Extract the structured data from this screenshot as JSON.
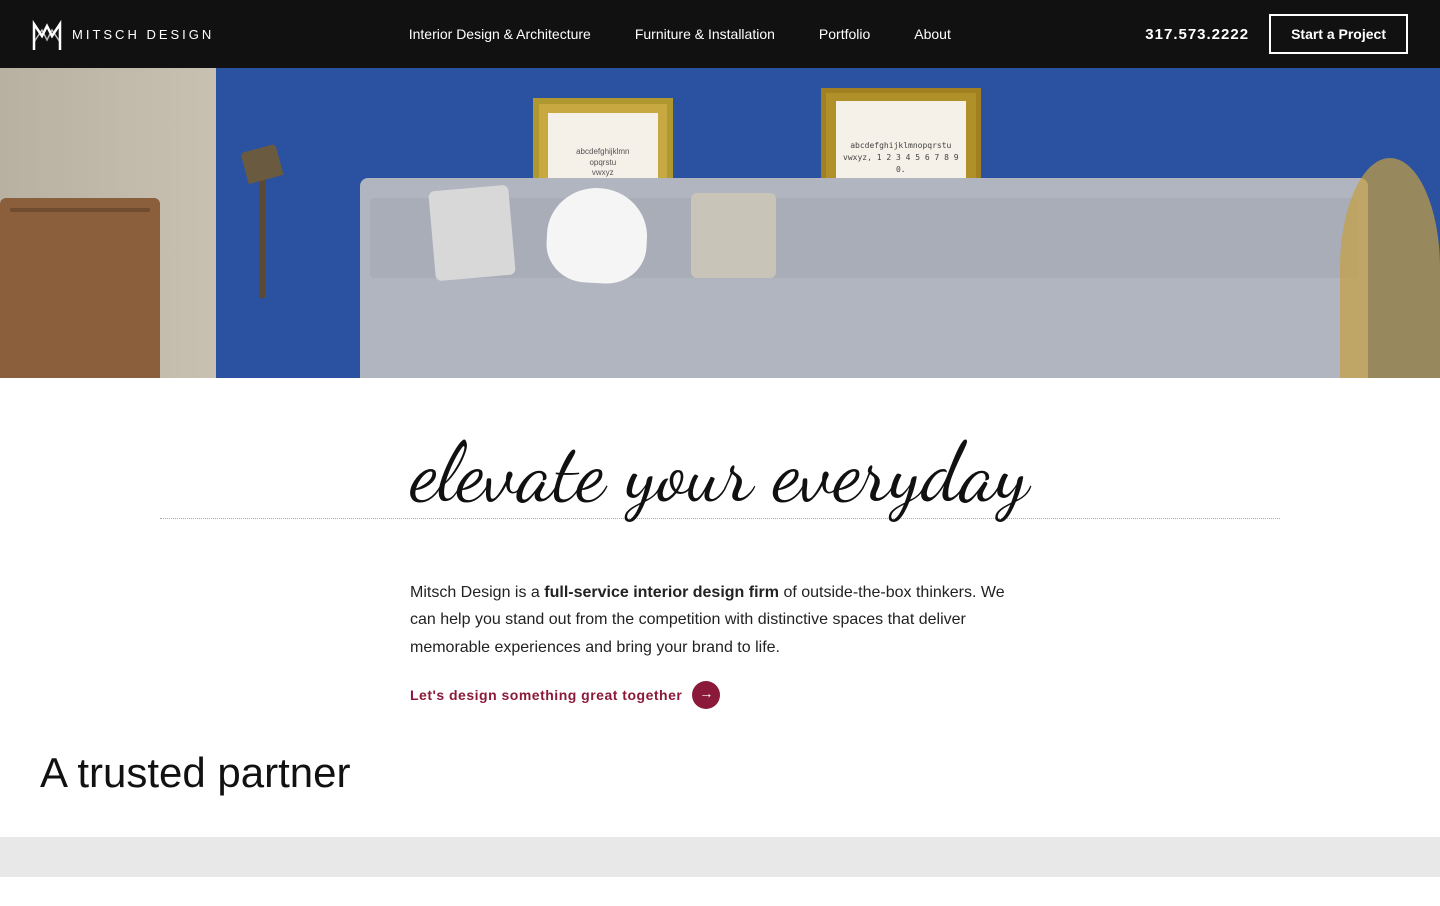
{
  "nav": {
    "logo_text": "MITSCH DESIGN",
    "links": [
      {
        "label": "Interior Design & Architecture",
        "id": "interior-design"
      },
      {
        "label": "Furniture & Installation",
        "id": "furniture"
      },
      {
        "label": "Portfolio",
        "id": "portfolio"
      },
      {
        "label": "About",
        "id": "about"
      }
    ],
    "phone": "317.573.2222",
    "cta_label": "Start a Project"
  },
  "hero": {
    "frame1_text": "abcdefghijklmn\nopqrstu\nvwxyz",
    "frame2_text": "abcdefghijklmnopqrstu\nvwxyz, 1234567890."
  },
  "tagline": {
    "line1": "elevate your everyday",
    "line2": ""
  },
  "description": {
    "prefix": "Mitsch Design is a ",
    "bold": "full-service interior design firm",
    "suffix": " of outside-the-box thinkers. We can help you stand out from the competition with distinctive spaces that deliver memorable experiences and bring your brand to life.",
    "cta_text": "Let's design something great together",
    "cta_arrow": "→"
  },
  "trusted": {
    "title": "A trusted partner"
  }
}
